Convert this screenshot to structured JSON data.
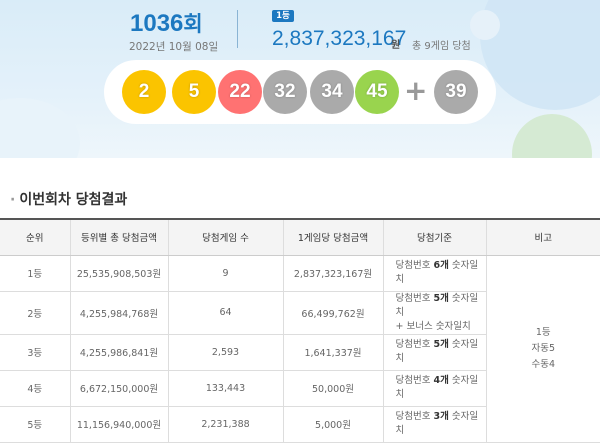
{
  "draw": {
    "round_number": "1036",
    "round_unit": "회",
    "date": "2022년 10월 08일",
    "first_prize_badge": "1등",
    "first_prize_amount": "2,837,323,167",
    "first_prize_unit": "원",
    "winner_count_text": "총 9게임 당첨"
  },
  "numbers": {
    "main": [
      {
        "value": "2",
        "color": "#fbc400"
      },
      {
        "value": "5",
        "color": "#fbc400"
      },
      {
        "value": "22",
        "color": "#ff7272"
      },
      {
        "value": "32",
        "color": "#aaaaaa"
      },
      {
        "value": "34",
        "color": "#aaaaaa"
      },
      {
        "value": "45",
        "color": "#99d44e"
      }
    ],
    "plus": "+",
    "bonus": {
      "value": "39",
      "color": "#aaaaaa"
    }
  },
  "section": {
    "bullet": "·",
    "title": "이번회차 당첨결과"
  },
  "table": {
    "headers": [
      "순위",
      "등위별 총 당첨금액",
      "당첨게임 수",
      "1게임당 당첨금액",
      "당첨기준",
      "비고"
    ],
    "rows": [
      {
        "rank": "1등",
        "total": "25,535,908,503원",
        "games": "9",
        "per_game": "2,837,323,167원",
        "std_pre": "당첨번호 ",
        "std_bold": "6개",
        "std_post": " 숫자일치",
        "std_line2": ""
      },
      {
        "rank": "2등",
        "total": "4,255,984,768원",
        "games": "64",
        "per_game": "66,499,762원",
        "std_pre": "당첨번호 ",
        "std_bold": "5개",
        "std_post": " 숫자일치",
        "std_line2": "+ 보너스 숫자일치"
      },
      {
        "rank": "3등",
        "total": "4,255,986,841원",
        "games": "2,593",
        "per_game": "1,641,337원",
        "std_pre": "당첨번호 ",
        "std_bold": "5개",
        "std_post": " 숫자일치",
        "std_line2": ""
      },
      {
        "rank": "4등",
        "total": "6,672,150,000원",
        "games": "133,443",
        "per_game": "50,000원",
        "std_pre": "당첨번호 ",
        "std_bold": "4개",
        "std_post": " 숫자일치",
        "std_line2": ""
      },
      {
        "rank": "5등",
        "total": "11,156,940,000원",
        "games": "2,231,388",
        "per_game": "5,000원",
        "std_pre": "당첨번호 ",
        "std_bold": "3개",
        "std_post": " 숫자일치",
        "std_line2": ""
      }
    ],
    "note": {
      "line1": "1등",
      "line2": "자동5",
      "line3": "수동4"
    }
  }
}
